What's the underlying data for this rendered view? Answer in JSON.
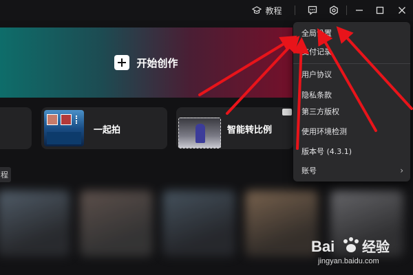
{
  "titlebar": {
    "tutorial_label": "教程",
    "icons": [
      "graduation-cap-icon",
      "feedback-icon",
      "settings-icon",
      "minimize-icon",
      "maximize-icon",
      "close-icon"
    ]
  },
  "banner": {
    "label": "开始创作",
    "icon": "plus-icon",
    "gradient_colors": [
      "#0e6d6a",
      "#74102a"
    ]
  },
  "cards": [
    {
      "label": "一起拍"
    },
    {
      "label": "智能转比例"
    }
  ],
  "tag": {
    "label": "程"
  },
  "menu": {
    "items": [
      {
        "label": "全局设置"
      },
      {
        "label": "支付记录"
      },
      {
        "label": "用户协议"
      },
      {
        "label": "隐私条款"
      },
      {
        "label": "第三方版权"
      },
      {
        "label": "使用环境检测"
      },
      {
        "label": "版本号 (4.3.1)"
      },
      {
        "label": "账号",
        "chevron": "›"
      }
    ]
  },
  "annotation_color": "#e8141a",
  "watermark": {
    "logo_text": "Bai 经验",
    "url": "jingyan.baidu.com"
  }
}
